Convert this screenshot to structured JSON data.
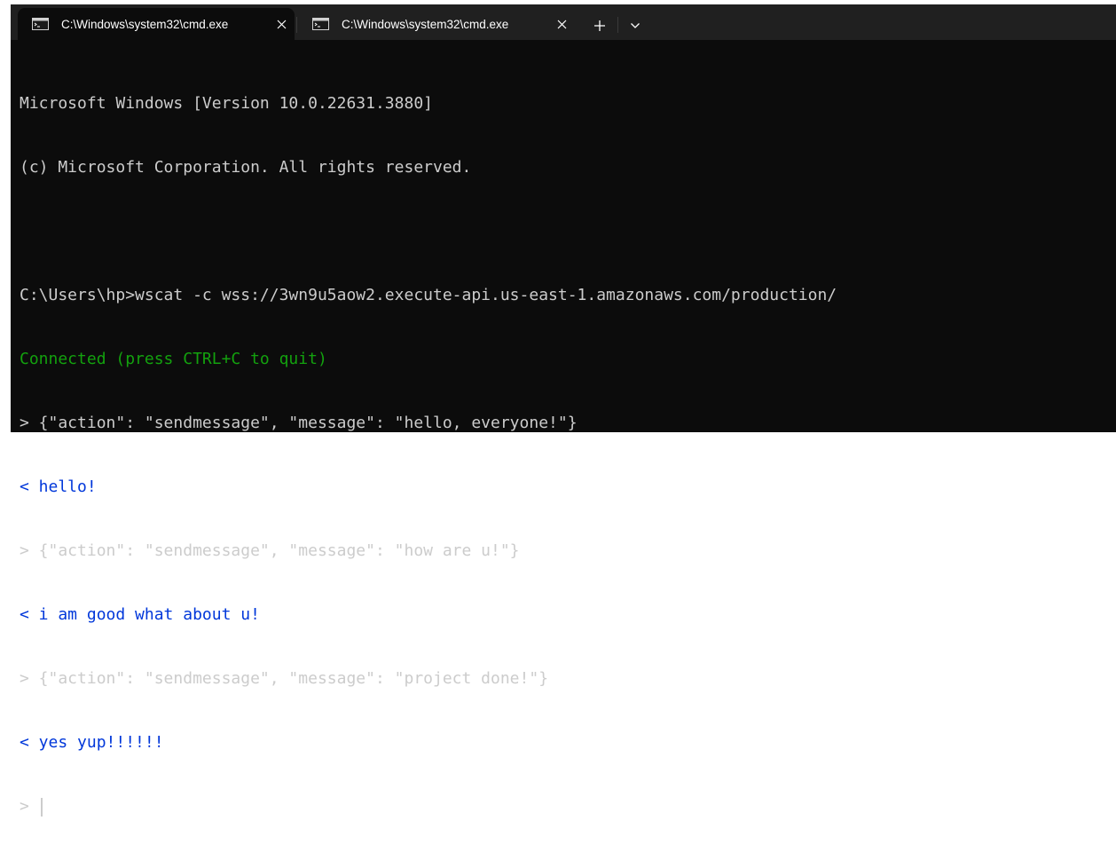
{
  "tabs": [
    {
      "title": "C:\\Windows\\system32\\cmd.exe",
      "icon": "cmd-icon",
      "active": true
    },
    {
      "title": "C:\\Windows\\system32\\cmd.exe",
      "icon": "cmd-icon",
      "active": false
    }
  ],
  "colors": {
    "terminal_bg": "#0c0c0c",
    "text": "#cccccc",
    "green": "#13a10e",
    "blue": "#0037da",
    "tabbar_bg": "#202020"
  },
  "terminal": {
    "lines": [
      {
        "text": "Microsoft Windows [Version 10.0.22631.3880]",
        "color": "white"
      },
      {
        "text": "(c) Microsoft Corporation. All rights reserved.",
        "color": "white"
      },
      {
        "text": "",
        "color": "white"
      },
      {
        "text": "C:\\Users\\hp>wscat -c wss://3wn9u5aow2.execute-api.us-east-1.amazonaws.com/production/",
        "color": "white"
      },
      {
        "text": "Connected (press CTRL+C to quit)",
        "color": "green"
      },
      {
        "text": "> {\"action\": \"sendmessage\", \"message\": \"hello, everyone!\"}",
        "color": "white"
      },
      {
        "text": "< hello!",
        "color": "blue"
      },
      {
        "text": "> {\"action\": \"sendmessage\", \"message\": \"how are u!\"}",
        "color": "white"
      },
      {
        "text": "< i am good what about u!",
        "color": "blue"
      },
      {
        "text": "> {\"action\": \"sendmessage\", \"message\": \"project done!\"}",
        "color": "white"
      },
      {
        "text": "< yes yup!!!!!!",
        "color": "blue"
      }
    ],
    "prompt": ">"
  }
}
